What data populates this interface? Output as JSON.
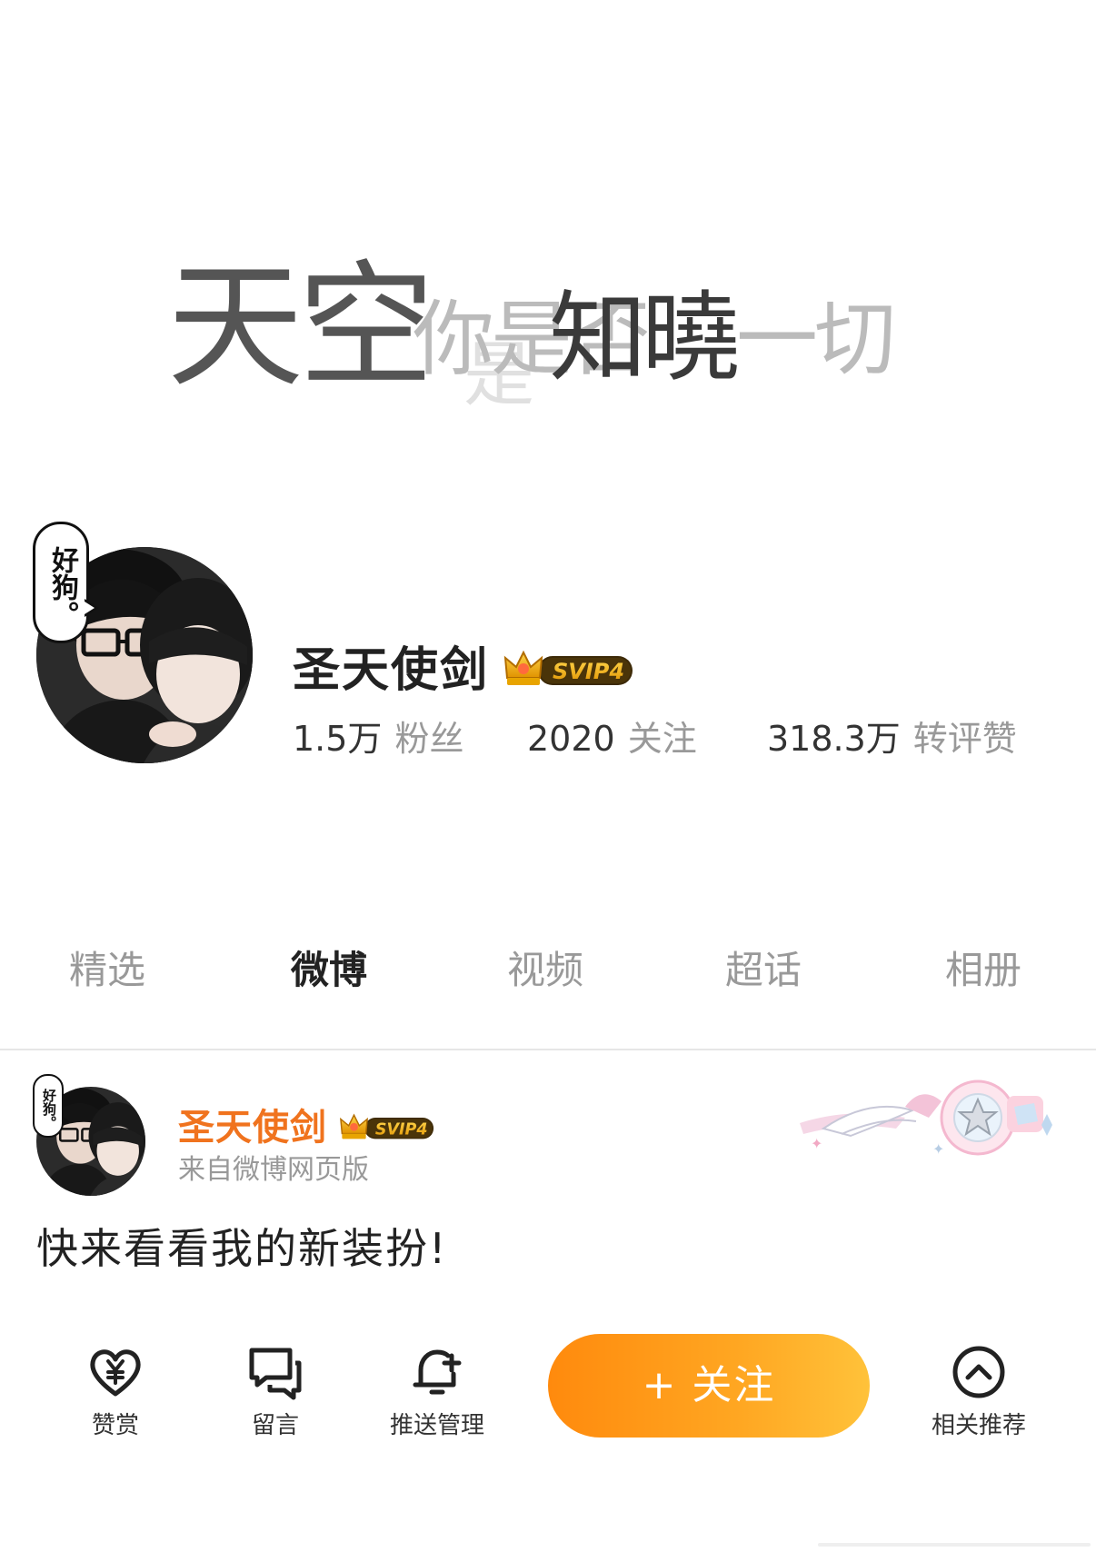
{
  "banner": {
    "line_big": "天空",
    "line_small_1": "你是否",
    "line_mid": "知曉",
    "line_small_2": "一切"
  },
  "profile": {
    "bubble_text": "好狗。",
    "name": "圣天使剑",
    "vip_badge": "SVIP4",
    "stats": [
      {
        "value": "1.5万",
        "label": "粉丝"
      },
      {
        "value": "2020",
        "label": "关注"
      },
      {
        "value": "318.3万",
        "label": "转评赞"
      }
    ]
  },
  "tabs": [
    {
      "label": "精选",
      "active": false
    },
    {
      "label": "微博",
      "active": true
    },
    {
      "label": "视频",
      "active": false
    },
    {
      "label": "超话",
      "active": false
    },
    {
      "label": "相册",
      "active": false
    }
  ],
  "post": {
    "bubble_text": "好狗。",
    "author": "圣天使剑",
    "vip_badge": "SVIP4",
    "source": "来自微博网页版",
    "text": "快来看看我的新装扮!"
  },
  "bottom_bar": {
    "reward_label": "赞赏",
    "message_label": "留言",
    "push_label": "推送管理",
    "follow_label": "+ 关注",
    "recommend_label": "相关推荐",
    "reward_icon": "heart-yen-icon",
    "message_icon": "chat-bubbles-icon",
    "push_icon": "bell-plus-icon",
    "recommend_icon": "chevron-up-circle-icon"
  },
  "colors": {
    "accent_orange": "#f0731e",
    "follow_gradient_start": "#ff8a0d",
    "follow_gradient_end": "#ffc23a",
    "gold": "#e2a100",
    "muted_text": "#999999"
  }
}
